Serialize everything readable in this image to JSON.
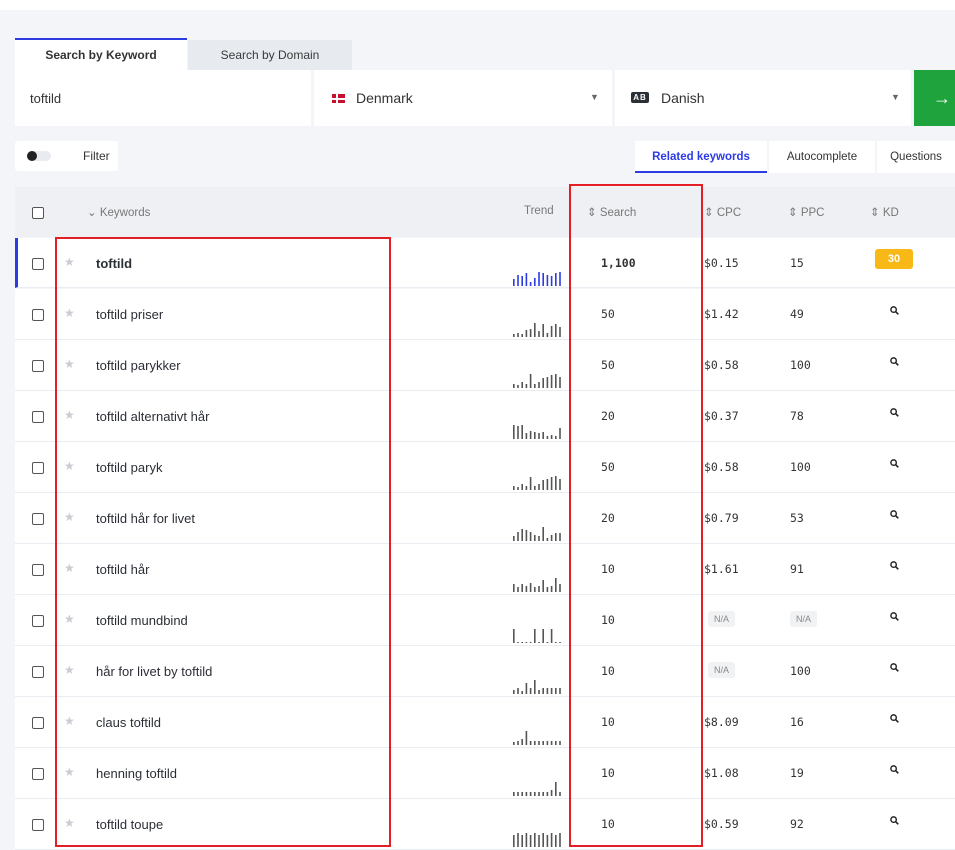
{
  "tabs": {
    "keyword": "Search by Keyword",
    "domain": "Search by Domain"
  },
  "search": {
    "value": "toftild",
    "country": "Denmark",
    "language": "Danish",
    "lang_icon": "translate-icon",
    "go_icon": "arrow-right-icon"
  },
  "filter": {
    "label": "Filter"
  },
  "modes": [
    "Related keywords",
    "Autocomplete",
    "Questions"
  ],
  "columns": {
    "keywords": "Keywords",
    "trend": "Trend",
    "search": "Search",
    "cpc": "CPC",
    "ppc": "PPC",
    "kd": "KD"
  },
  "colors": {
    "accent": "#2d3be5",
    "go": "#1fa33d",
    "kd_badge": "#f8b816",
    "highlight": "#e41e26"
  },
  "rows": [
    {
      "keyword": "toftild",
      "search": "1,100",
      "cpc": "$0.15",
      "ppc": "15",
      "kd": "30",
      "trend": [
        5,
        8,
        7,
        9,
        3,
        6,
        10,
        9,
        8,
        7,
        9,
        10
      ]
    },
    {
      "keyword": "toftild priser",
      "search": "50",
      "cpc": "$1.42",
      "ppc": "49",
      "kd": null,
      "trend": [
        2,
        3,
        2,
        5,
        6,
        10,
        4,
        9,
        3,
        8,
        9,
        7
      ]
    },
    {
      "keyword": "toftild parykker",
      "search": "50",
      "cpc": "$0.58",
      "ppc": "100",
      "kd": null,
      "trend": [
        3,
        2,
        4,
        3,
        10,
        3,
        4,
        7,
        8,
        9,
        10,
        8
      ]
    },
    {
      "keyword": "toftild alternativt hår",
      "search": "20",
      "cpc": "$0.37",
      "ppc": "78",
      "kd": null,
      "trend": [
        10,
        9,
        10,
        4,
        6,
        5,
        4,
        5,
        2,
        3,
        2,
        8
      ]
    },
    {
      "keyword": "toftild paryk",
      "search": "50",
      "cpc": "$0.58",
      "ppc": "100",
      "kd": null,
      "trend": [
        3,
        2,
        4,
        3,
        9,
        3,
        4,
        7,
        8,
        9,
        10,
        8
      ]
    },
    {
      "keyword": "toftild hår for livet",
      "search": "20",
      "cpc": "$0.79",
      "ppc": "53",
      "kd": null,
      "trend": [
        3,
        6,
        8,
        7,
        6,
        4,
        3,
        9,
        2,
        4,
        5,
        5
      ]
    },
    {
      "keyword": "toftild hår",
      "search": "10",
      "cpc": "$1.61",
      "ppc": "91",
      "kd": null,
      "trend": [
        5,
        3,
        5,
        4,
        6,
        3,
        4,
        8,
        3,
        4,
        9,
        5
      ]
    },
    {
      "keyword": "toftild mundbind",
      "search": "10",
      "cpc": "N/A",
      "ppc": "N/A",
      "kd": null,
      "trend": [
        10,
        1,
        1,
        1,
        1,
        10,
        1,
        10,
        1,
        10,
        1,
        1
      ]
    },
    {
      "keyword": "hår for livet by toftild",
      "search": "10",
      "cpc": "N/A",
      "ppc": "100",
      "kd": null,
      "trend": [
        3,
        4,
        2,
        8,
        4,
        10,
        3,
        4,
        4,
        4,
        4,
        4
      ]
    },
    {
      "keyword": "claus toftild",
      "search": "10",
      "cpc": "$8.09",
      "ppc": "16",
      "kd": null,
      "trend": [
        2,
        3,
        4,
        10,
        3,
        3,
        3,
        3,
        3,
        3,
        3,
        3
      ]
    },
    {
      "keyword": "henning toftild",
      "search": "10",
      "cpc": "$1.08",
      "ppc": "19",
      "kd": null,
      "trend": [
        3,
        3,
        3,
        3,
        3,
        3,
        3,
        3,
        3,
        4,
        10,
        3
      ]
    },
    {
      "keyword": "toftild toupe",
      "search": "10",
      "cpc": "$0.59",
      "ppc": "92",
      "kd": null,
      "trend": [
        8,
        9,
        8,
        9,
        8,
        9,
        8,
        9,
        8,
        9,
        8,
        9
      ]
    }
  ]
}
